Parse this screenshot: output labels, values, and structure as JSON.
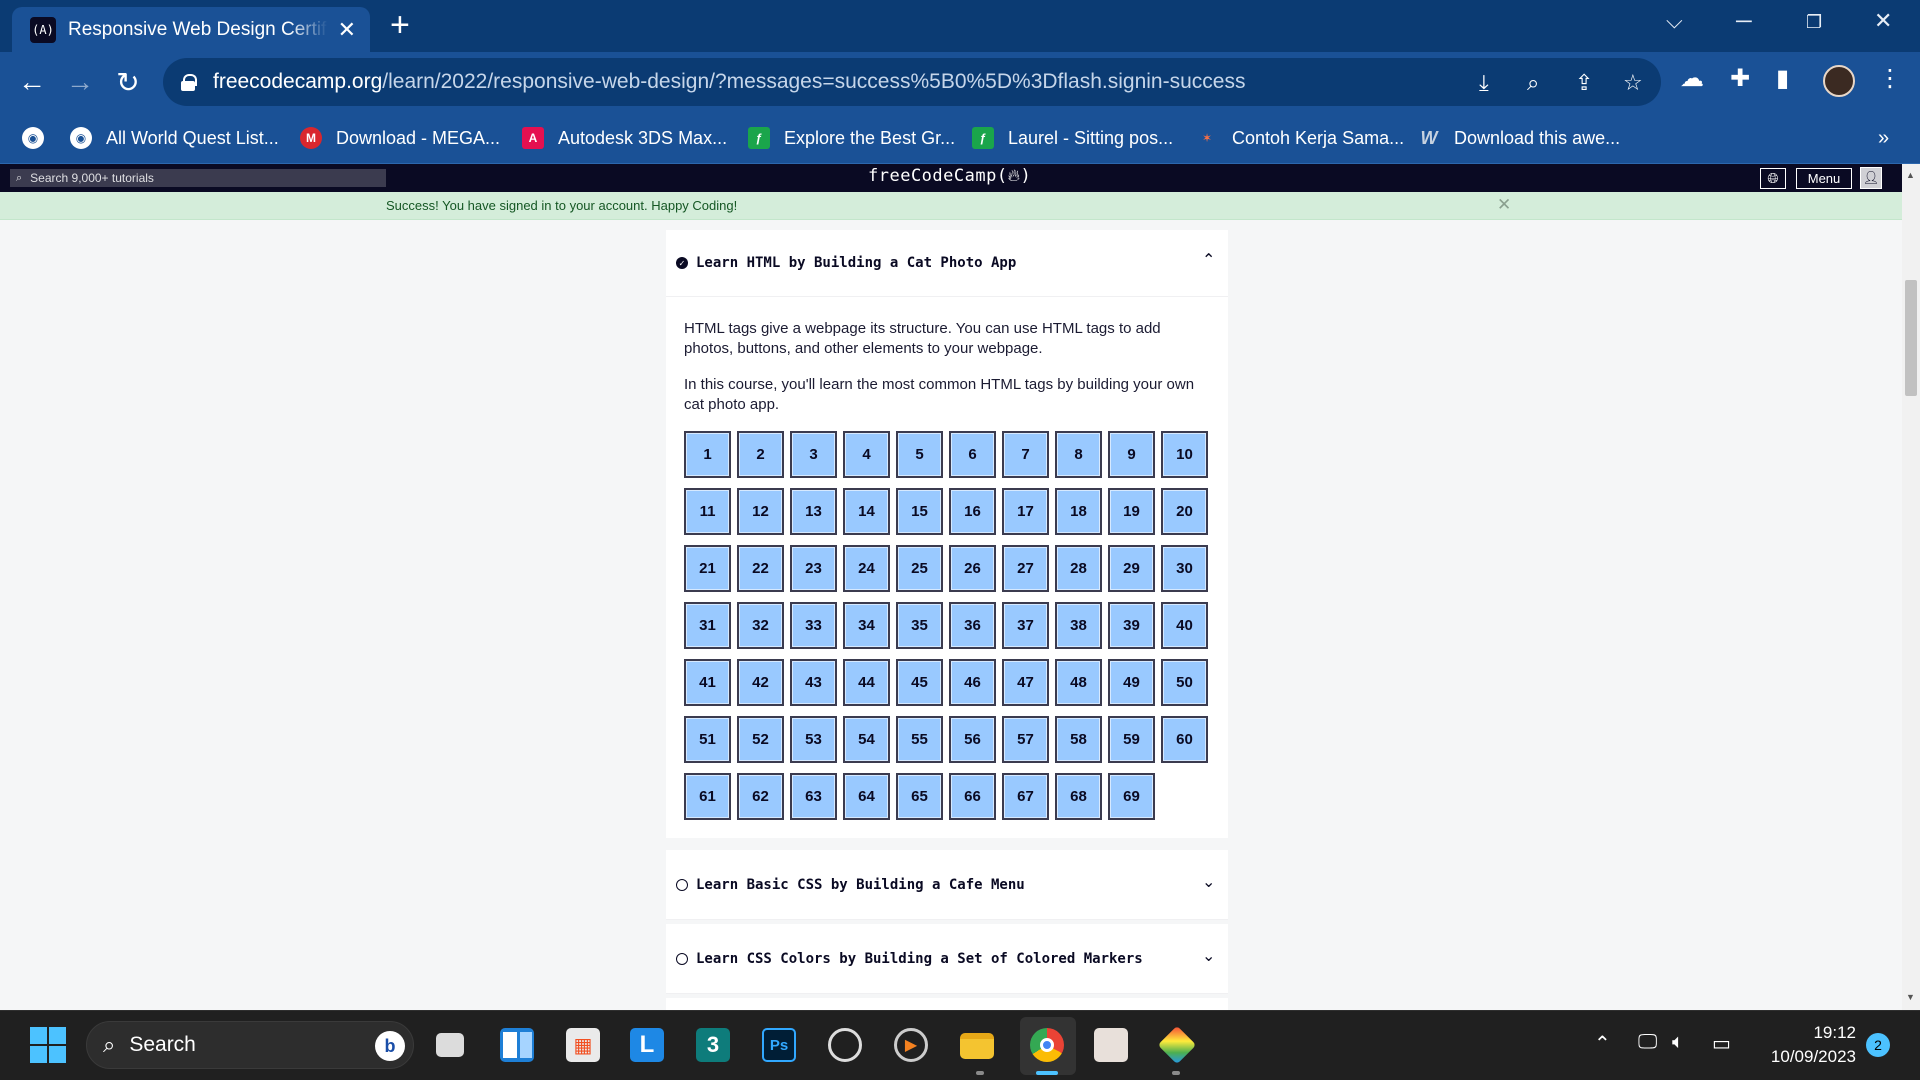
{
  "browser": {
    "tab_title": "Responsive Web Design Certification",
    "tab_favicon": "(A)",
    "tab_close": "✕",
    "new_tab": "+",
    "url_host": "freecodecamp.org",
    "url_path": "/learn/2022/responsive-web-design/?messages=success%5B0%5D%3Dflash.signin-success",
    "bookmarks": [
      {
        "label": "All World Quest List...",
        "icon": "globe-icon",
        "color": "#5f6368"
      },
      {
        "label": "Download - MEGA...",
        "icon": "mega-icon",
        "color": "#d9272e"
      },
      {
        "label": "Autodesk 3DS Max...",
        "icon": "autodesk-icon",
        "color": "#e51050"
      },
      {
        "label": "Explore the Best Gr...",
        "icon": "freepik-icon",
        "color": "#1aa54b"
      },
      {
        "label": "Laurel - Sitting pos...",
        "icon": "freepik-icon",
        "color": "#1aa54b"
      },
      {
        "label": "Contoh Kerja Sama...",
        "icon": "kerja-icon",
        "color": "#d84315"
      },
      {
        "label": "Download this awe...",
        "icon": "w-icon",
        "color": "#5b6f8a"
      }
    ],
    "bookmarks_overflow": "»"
  },
  "fcc": {
    "search_placeholder": "Search 9,000+ tutorials",
    "logo": "freeCodeCamp(🔥)",
    "logo_text": "freeCodeCamp(",
    "logo_flame": "A",
    "logo_close": ")",
    "menu_label": "Menu",
    "flash_message": "Success! You have signed in to your account. Happy Coding!",
    "flash_close": "✕"
  },
  "main": {
    "blocks": [
      {
        "title": "Learn HTML by Building a Cat Photo App",
        "completed": true,
        "expanded": true,
        "description": [
          "HTML tags give a webpage its structure. You can use HTML tags to add photos, buttons, and other elements to your webpage.",
          "In this course, you'll learn the most common HTML tags by building your own cat photo app."
        ],
        "step_count": 69
      },
      {
        "title": "Learn Basic CSS by Building a Cafe Menu",
        "completed": false,
        "expanded": false
      },
      {
        "title": "Learn CSS Colors by Building a Set of Colored Markers",
        "completed": false,
        "expanded": false
      }
    ]
  },
  "taskbar": {
    "search_label": "Search",
    "time": "19:12",
    "date": "10/09/2023",
    "notification_count": "2",
    "apps": [
      {
        "name": "task-view",
        "label": ""
      },
      {
        "name": "widgets",
        "label": ""
      },
      {
        "name": "microsoft-store",
        "label": ""
      },
      {
        "name": "app-l",
        "label": "L"
      },
      {
        "name": "app-3",
        "label": "3"
      },
      {
        "name": "photoshop",
        "label": "Ps"
      },
      {
        "name": "app-search",
        "label": ""
      },
      {
        "name": "media-player",
        "label": "▶"
      },
      {
        "name": "file-explorer",
        "label": ""
      },
      {
        "name": "chrome",
        "label": ""
      },
      {
        "name": "app-character",
        "label": ""
      },
      {
        "name": "bluestacks",
        "label": ""
      }
    ]
  },
  "colors": {
    "tabstrip": "#0b3b73",
    "toolbar": "#1a5196",
    "fcc_nav": "#0a0a23",
    "flash_bg": "#d4edda",
    "step_bg": "#99c9ff"
  }
}
